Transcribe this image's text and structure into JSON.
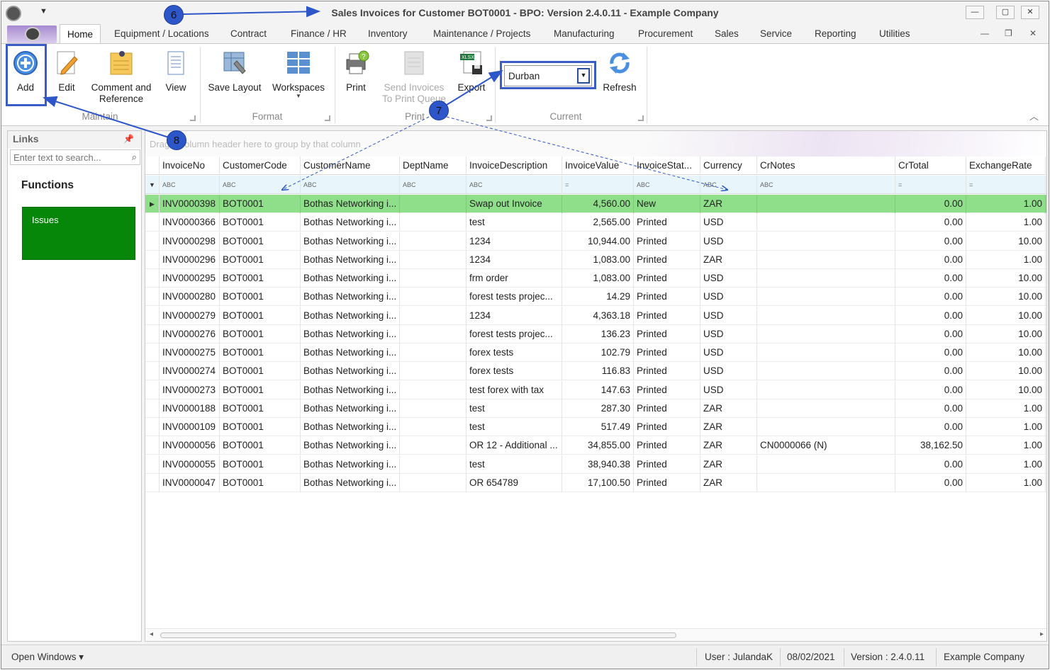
{
  "window": {
    "title": "Sales Invoices for Customer BOT0001 - BPO: Version 2.4.0.11 - Example Company",
    "controls": {
      "minimize": "—",
      "maximize": "▢",
      "close": "✕"
    }
  },
  "tabs": [
    "Home",
    "Equipment / Locations",
    "Contract",
    "Finance / HR",
    "Inventory",
    "Maintenance / Projects",
    "Manufacturing",
    "Procurement",
    "Sales",
    "Service",
    "Reporting",
    "Utilities"
  ],
  "ribbon": {
    "maintain": {
      "label": "Maintain",
      "add": "Add",
      "edit": "Edit",
      "comment": "Comment and Reference",
      "view": "View"
    },
    "format": {
      "label": "Format",
      "save_layout": "Save Layout",
      "workspaces": "Workspaces"
    },
    "print": {
      "label": "Print",
      "print": "Print",
      "send_invoices": "Send Invoices To Print Queue",
      "export": "Export"
    },
    "current": {
      "label": "Current",
      "site": "Durban",
      "refresh": "Refresh"
    }
  },
  "links": {
    "title": "Links",
    "search_placeholder": "Enter text to search...",
    "functions_title": "Functions",
    "tile": "Issues"
  },
  "grid": {
    "group_hint": "Drag a column header here to group by that column",
    "columns": [
      "InvoiceNo",
      "CustomerCode",
      "CustomerName",
      "DeptName",
      "InvoiceDescription",
      "InvoiceValue",
      "InvoiceStat...",
      "Currency",
      "CrNotes",
      "CrTotal",
      "ExchangeRate"
    ],
    "filter_icons": [
      "ABC",
      "ABC",
      "ABC",
      "ABC",
      "ABC",
      "=",
      "ABC",
      "ABC",
      "ABC",
      "=",
      "="
    ],
    "rows": [
      [
        "INV0000398",
        "BOT0001",
        "Bothas Networking i...",
        "",
        "Swap out Invoice",
        "4,560.00",
        "New",
        "ZAR",
        "",
        "0.00",
        "1.00"
      ],
      [
        "INV0000366",
        "BOT0001",
        "Bothas Networking i...",
        "",
        "test",
        "2,565.00",
        "Printed",
        "USD",
        "",
        "0.00",
        "1.00"
      ],
      [
        "INV0000298",
        "BOT0001",
        "Bothas Networking i...",
        "",
        "1234",
        "10,944.00",
        "Printed",
        "USD",
        "",
        "0.00",
        "10.00"
      ],
      [
        "INV0000296",
        "BOT0001",
        "Bothas Networking i...",
        "",
        "1234",
        "1,083.00",
        "Printed",
        "ZAR",
        "",
        "0.00",
        "1.00"
      ],
      [
        "INV0000295",
        "BOT0001",
        "Bothas Networking i...",
        "",
        "frm order",
        "1,083.00",
        "Printed",
        "USD",
        "",
        "0.00",
        "10.00"
      ],
      [
        "INV0000280",
        "BOT0001",
        "Bothas Networking i...",
        "",
        "forest tests projec...",
        "14.29",
        "Printed",
        "USD",
        "",
        "0.00",
        "10.00"
      ],
      [
        "INV0000279",
        "BOT0001",
        "Bothas Networking i...",
        "",
        "1234",
        "4,363.18",
        "Printed",
        "USD",
        "",
        "0.00",
        "10.00"
      ],
      [
        "INV0000276",
        "BOT0001",
        "Bothas Networking i...",
        "",
        "forest tests projec...",
        "136.23",
        "Printed",
        "USD",
        "",
        "0.00",
        "10.00"
      ],
      [
        "INV0000275",
        "BOT0001",
        "Bothas Networking i...",
        "",
        "forex tests",
        "102.79",
        "Printed",
        "USD",
        "",
        "0.00",
        "10.00"
      ],
      [
        "INV0000274",
        "BOT0001",
        "Bothas Networking i...",
        "",
        "forex tests",
        "116.83",
        "Printed",
        "USD",
        "",
        "0.00",
        "10.00"
      ],
      [
        "INV0000273",
        "BOT0001",
        "Bothas Networking i...",
        "",
        "test forex with tax",
        "147.63",
        "Printed",
        "USD",
        "",
        "0.00",
        "10.00"
      ],
      [
        "INV0000188",
        "BOT0001",
        "Bothas Networking i...",
        "",
        "test",
        "287.30",
        "Printed",
        "ZAR",
        "",
        "0.00",
        "1.00"
      ],
      [
        "INV0000109",
        "BOT0001",
        "Bothas Networking i...",
        "",
        "test",
        "517.49",
        "Printed",
        "ZAR",
        "",
        "0.00",
        "1.00"
      ],
      [
        "INV0000056",
        "BOT0001",
        "Bothas Networking i...",
        "",
        "OR 12 - Additional ...",
        "34,855.00",
        "Printed",
        "ZAR",
        "CN0000066 (N)",
        "38,162.50",
        "1.00"
      ],
      [
        "INV0000055",
        "BOT0001",
        "Bothas Networking i...",
        "",
        "test",
        "38,940.38",
        "Printed",
        "ZAR",
        "",
        "0.00",
        "1.00"
      ],
      [
        "INV0000047",
        "BOT0001",
        "Bothas Networking i...",
        "",
        "OR 654789",
        "17,100.50",
        "Printed",
        "ZAR",
        "",
        "0.00",
        "1.00"
      ]
    ]
  },
  "status": {
    "open_windows": "Open Windows ▾",
    "user": "User : JulandaK",
    "date": "08/02/2021",
    "version": "Version : 2.4.0.11",
    "company": "Example Company"
  },
  "annotations": {
    "c6": "6",
    "c7": "7",
    "c8": "8"
  },
  "colors": {
    "selected_row": "#8fdf8a",
    "issues_tile": "#06870a",
    "callout": "#2d56c8",
    "highlight": "#3a5cc8"
  }
}
